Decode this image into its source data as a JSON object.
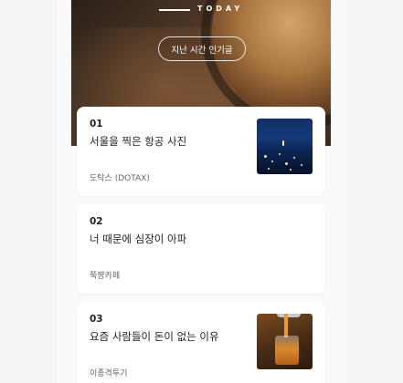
{
  "hero": {
    "label": "TODAY",
    "button_label": "지난 시간 인기글"
  },
  "articles": [
    {
      "number": "01",
      "title": "서울을 찍은 항공 사진",
      "author": "도탁스 (DOTAX)",
      "thumbnail": "city-night-photo"
    },
    {
      "number": "02",
      "title": "너 때문에 심장이 아파",
      "author": "쭉쨩카페",
      "thumbnail": ""
    },
    {
      "number": "03",
      "title": "요즘 사람들이 돈이 없는 이유",
      "author": "이종격투기",
      "thumbnail": "whiskey-glass-photo"
    }
  ]
}
